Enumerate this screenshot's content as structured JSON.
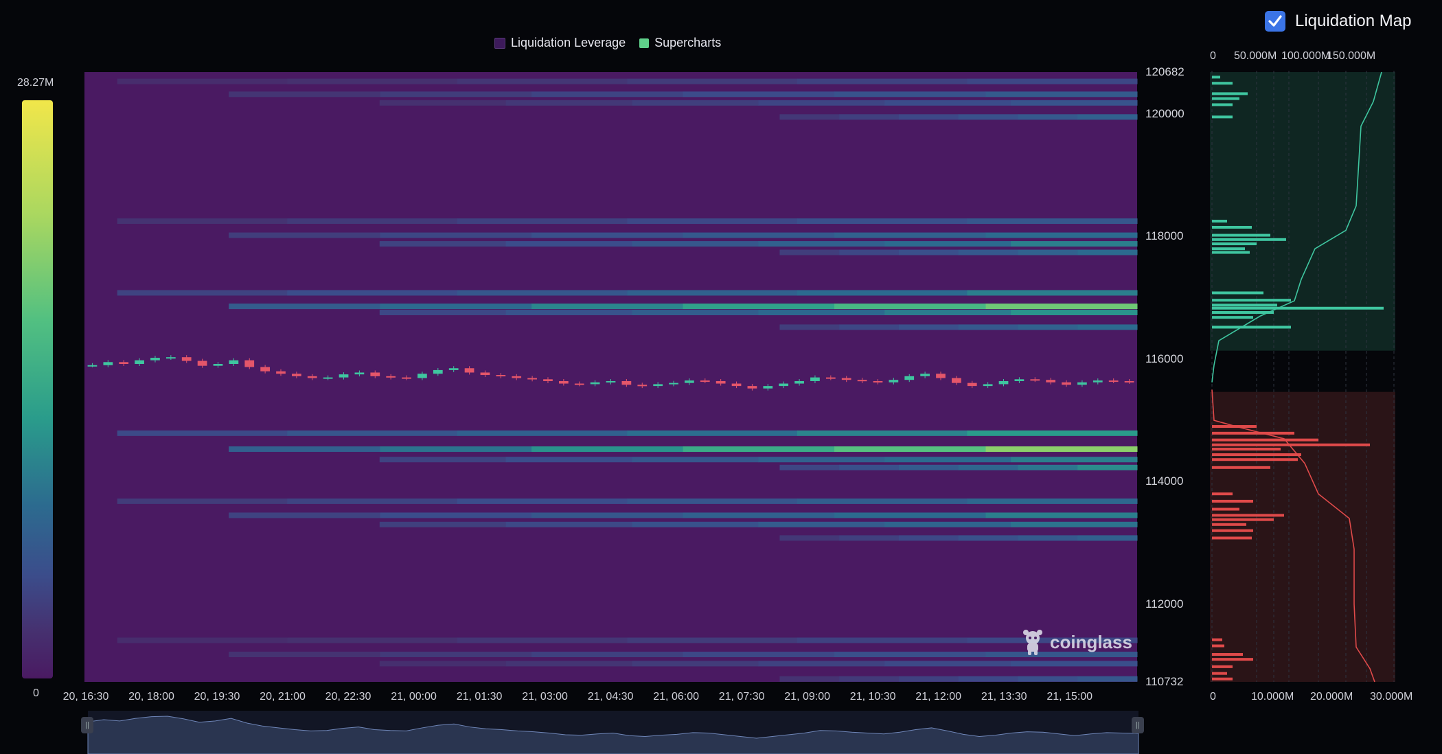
{
  "legend": {
    "items": [
      {
        "label": "Liquidation Leverage",
        "color": "#3d1a5b"
      },
      {
        "label": "Supercharts",
        "color": "#5fd08a"
      }
    ]
  },
  "toggle": {
    "label": "Liquidation Map",
    "checked": true,
    "icon": "checkmark-icon"
  },
  "colorbar": {
    "max_label": "28.27M",
    "min_label": "0"
  },
  "logo": {
    "text": "coinglass",
    "icon": "coinglass-mascot-icon"
  },
  "chart_data": [
    {
      "type": "heatmap",
      "title": "",
      "x_ticks": [
        "20, 16:30",
        "20, 18:00",
        "20, 19:30",
        "20, 21:00",
        "20, 22:30",
        "21, 00:00",
        "21, 01:30",
        "21, 03:00",
        "21, 04:30",
        "21, 06:00",
        "21, 07:30",
        "21, 09:00",
        "21, 10:30",
        "21, 12:00",
        "21, 13:30",
        "21, 15:00"
      ],
      "y_ticks": [
        "120682",
        "120000",
        "118000",
        "116000",
        "114000",
        "112000",
        "110732"
      ],
      "ylim": [
        110732,
        120682
      ],
      "color_scale": {
        "min": 0,
        "max": 28.27,
        "unit": "M"
      },
      "bands": [
        {
          "price": 120530,
          "start": 0.5,
          "level": 0.32
        },
        {
          "price": 120320,
          "start": 2.2,
          "level": 0.42
        },
        {
          "price": 120180,
          "start": 4.5,
          "level": 0.38
        },
        {
          "price": 119950,
          "start": 10.6,
          "level": 0.45
        },
        {
          "price": 118250,
          "start": 0.5,
          "level": 0.4
        },
        {
          "price": 118020,
          "start": 2.2,
          "level": 0.5
        },
        {
          "price": 117880,
          "start": 4.5,
          "level": 0.55
        },
        {
          "price": 117740,
          "start": 10.6,
          "level": 0.5
        },
        {
          "price": 117080,
          "start": 0.5,
          "level": 0.55
        },
        {
          "price": 116860,
          "start": 2.2,
          "level": 0.78
        },
        {
          "price": 116760,
          "start": 4.5,
          "level": 0.6
        },
        {
          "price": 116520,
          "start": 10.6,
          "level": 0.5
        },
        {
          "price": 114790,
          "start": 0.5,
          "level": 0.62
        },
        {
          "price": 114530,
          "start": 2.2,
          "level": 0.82
        },
        {
          "price": 114360,
          "start": 4.5,
          "level": 0.55
        },
        {
          "price": 114230,
          "start": 10.6,
          "level": 0.58
        },
        {
          "price": 113680,
          "start": 0.5,
          "level": 0.48
        },
        {
          "price": 113450,
          "start": 2.2,
          "level": 0.55
        },
        {
          "price": 113300,
          "start": 4.5,
          "level": 0.52
        },
        {
          "price": 113080,
          "start": 10.6,
          "level": 0.45
        },
        {
          "price": 111410,
          "start": 0.5,
          "level": 0.32
        },
        {
          "price": 111180,
          "start": 2.2,
          "level": 0.4
        },
        {
          "price": 111030,
          "start": 4.5,
          "level": 0.36
        },
        {
          "price": 110780,
          "start": 10.6,
          "level": 0.4
        }
      ],
      "candles_close": [
        115900,
        115950,
        115920,
        115980,
        116020,
        116030,
        115970,
        115890,
        115920,
        115980,
        115870,
        115800,
        115760,
        115720,
        115690,
        115700,
        115750,
        115780,
        115720,
        115700,
        115690,
        115760,
        115820,
        115850,
        115780,
        115740,
        115720,
        115690,
        115670,
        115640,
        115600,
        115590,
        115620,
        115640,
        115580,
        115560,
        115590,
        115610,
        115650,
        115640,
        115600,
        115560,
        115520,
        115560,
        115600,
        115640,
        115700,
        115690,
        115660,
        115640,
        115620,
        115660,
        115720,
        115760,
        115690,
        115610,
        115560,
        115590,
        115640,
        115670,
        115660,
        115620,
        115580,
        115620,
        115650,
        115640,
        115630
      ]
    },
    {
      "type": "bar",
      "title": "",
      "orientation": "horizontal",
      "x_ticks": [
        "0",
        "50.000M",
        "100.000M",
        "150.000M"
      ],
      "x_ticks_bottom": [
        "0",
        "10.000M",
        "20.000M",
        "30.000M"
      ],
      "series": [
        {
          "color": "#3fc6a0"
        },
        {
          "color": "#e04a4a"
        }
      ]
    }
  ]
}
